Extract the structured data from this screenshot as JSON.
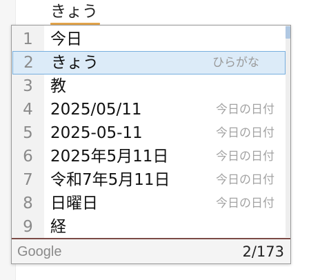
{
  "composition": {
    "text": "きょう"
  },
  "candidates": [
    {
      "num": "1",
      "text": "今日",
      "desc": ""
    },
    {
      "num": "2",
      "text": "きょう",
      "desc": "ひらがな"
    },
    {
      "num": "3",
      "text": "教",
      "desc": ""
    },
    {
      "num": "4",
      "text": "2025/05/11",
      "desc": "今日の日付"
    },
    {
      "num": "5",
      "text": "2025-05-11",
      "desc": "今日の日付"
    },
    {
      "num": "6",
      "text": "2025年5月11日",
      "desc": "今日の日付"
    },
    {
      "num": "7",
      "text": "令和7年5月11日",
      "desc": "今日の日付"
    },
    {
      "num": "8",
      "text": "日曜日",
      "desc": "今日の日付"
    },
    {
      "num": "9",
      "text": "経",
      "desc": ""
    }
  ],
  "selected_index": 2,
  "footer": {
    "brand": "Google",
    "count": "2/173"
  },
  "colors": {
    "selection_bg": "#dcebf8",
    "selection_border": "#76aede",
    "underline": "#e5a54c",
    "footer_rule": "#7b4a45",
    "scroll_thumb": "#b0c8e2"
  }
}
